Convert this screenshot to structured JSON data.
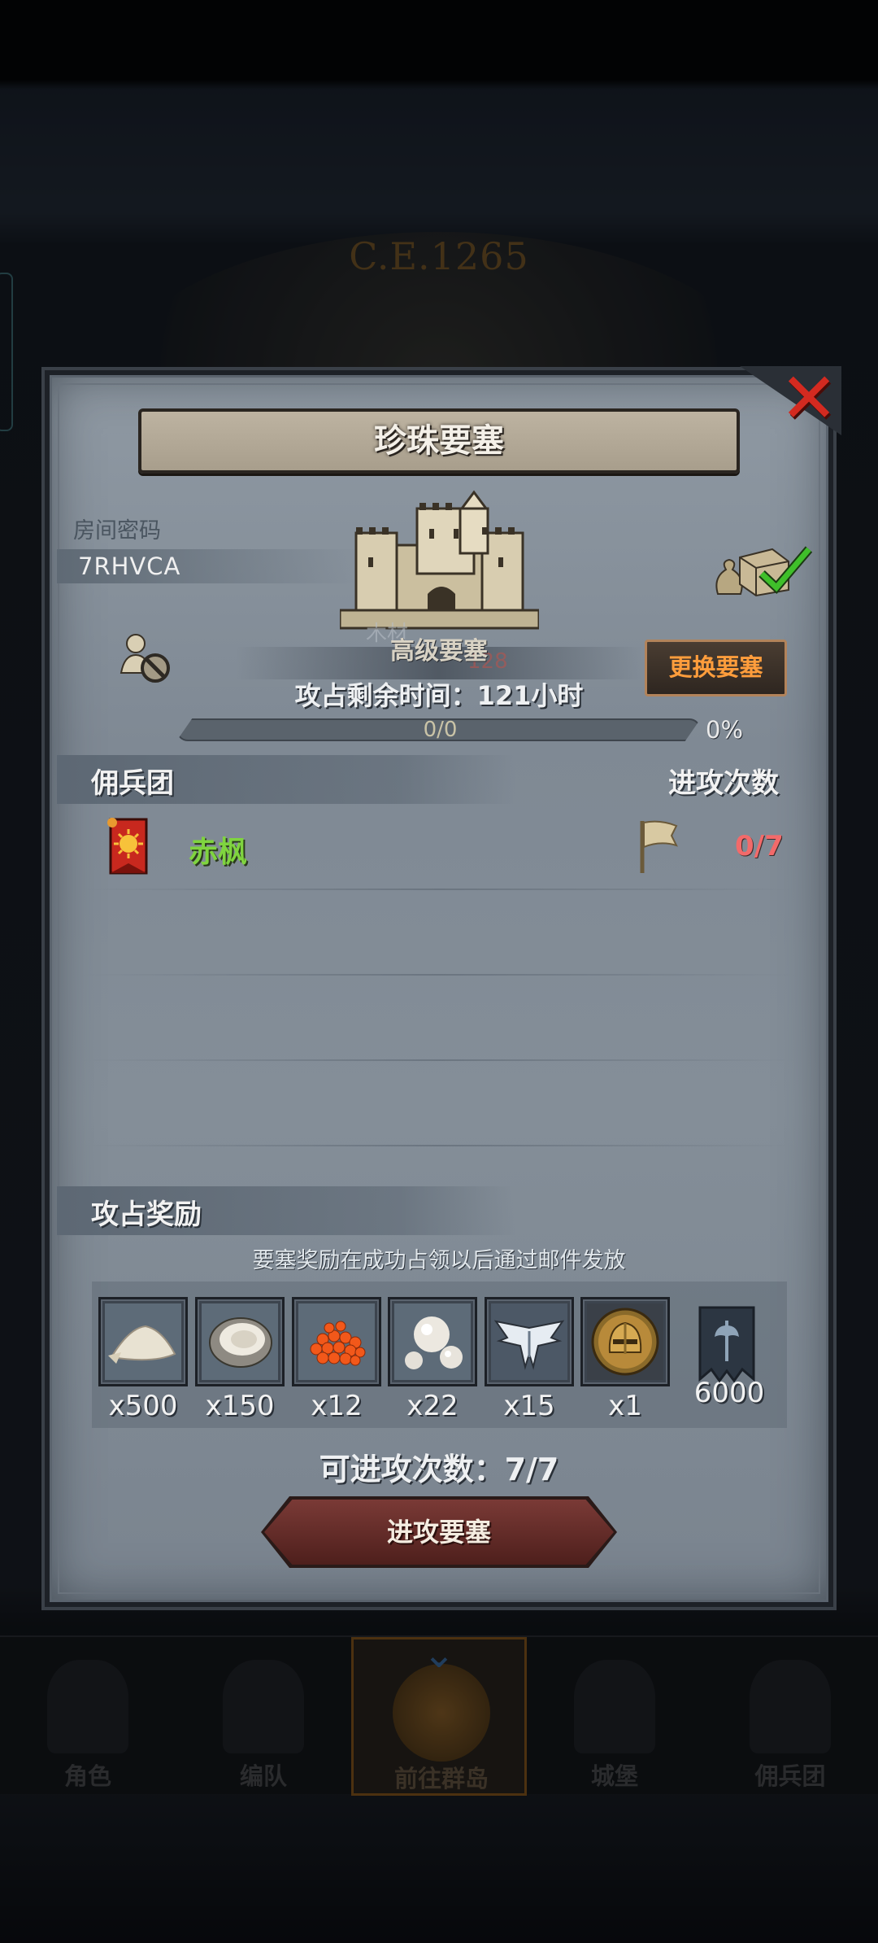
{
  "background": {
    "year": "C.E.1265",
    "bottom_nav": [
      {
        "label": "角色",
        "icon": "knight-icon"
      },
      {
        "label": "编队",
        "icon": "helmet-icon"
      },
      {
        "label": "前往群岛",
        "icon": "island-compass-icon",
        "active": true
      },
      {
        "label": "城堡",
        "icon": "castle-icon"
      },
      {
        "label": "佣兵团",
        "icon": "mercenary-icon"
      }
    ]
  },
  "dialog": {
    "title": "珍珠要塞",
    "room_label": "房间密码",
    "room_code": "7RHVCA",
    "behind_text": "木材",
    "behind_number": "128",
    "fortress_type": "高级要塞",
    "time_left": "攻占剩余时间：121小时",
    "change_button": "更换要塞",
    "progress": {
      "text": "0/0",
      "percent_label": "0%",
      "fraction": 0
    },
    "mercenary_section": {
      "title": "佣兵团",
      "attacks_header": "进攻次数"
    },
    "mercenaries": [
      {
        "name": "赤枫",
        "attacks": "0/7",
        "icon": "sun-banner-icon"
      }
    ],
    "rewards_section": {
      "title": "攻占奖励",
      "note": "要塞奖励在成功占领以后通过邮件发放",
      "items": [
        {
          "icon": "salt-pile-icon",
          "count": "x500"
        },
        {
          "icon": "oyster-icon",
          "count": "x150"
        },
        {
          "icon": "fish-roe-icon",
          "count": "x12"
        },
        {
          "icon": "pearl-icon",
          "count": "x22"
        },
        {
          "icon": "winged-emblem-icon",
          "count": "x15"
        },
        {
          "icon": "golden-helmet-icon",
          "count": "x1"
        },
        {
          "icon": "war-banner-icon",
          "count": "6000"
        }
      ]
    },
    "attacks_available": "可进攻次数：7/7",
    "attack_button": "进攻要塞"
  },
  "colors": {
    "accent_orange": "#ff9d3c",
    "merc_name_green": "#7fd43f",
    "attacks_red": "#f26a6a",
    "close_red": "#d42a20"
  }
}
